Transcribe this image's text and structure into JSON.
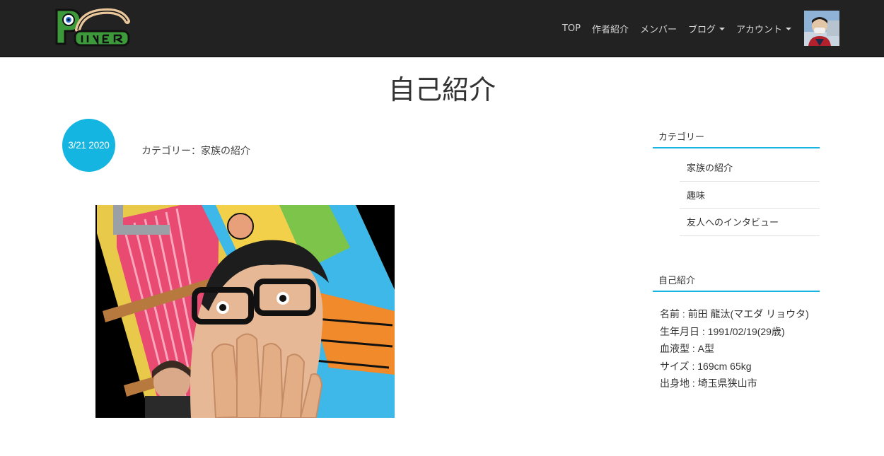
{
  "nav": {
    "items": [
      {
        "label": "TOP",
        "dropdown": false
      },
      {
        "label": "作者紹介",
        "dropdown": false
      },
      {
        "label": "メンバー",
        "dropdown": false
      },
      {
        "label": "ブログ",
        "dropdown": true
      },
      {
        "label": "アカウント",
        "dropdown": true
      }
    ],
    "colors": {
      "bar": "#222222",
      "text": "#d6d6d6"
    }
  },
  "page": {
    "title": "自己紹介"
  },
  "post": {
    "date": "3/21 2020",
    "category_line": "カテゴリー：家族の紹介",
    "accent_color": "#14b5e0"
  },
  "sidebar": {
    "category_title": "カテゴリー",
    "categories": [
      "家族の紹介",
      "趣味",
      "友人へのインタビュー"
    ],
    "profile_title": "自己紹介",
    "profile_lines": [
      "名前 : 前田 龍汰(マエダ リョウタ)",
      "生年月日 : 1991/02/19(29歳)",
      "血液型 : A型",
      "サイズ : 169cm 65kg",
      "出身地 : 埼玉県狭山市"
    ]
  }
}
